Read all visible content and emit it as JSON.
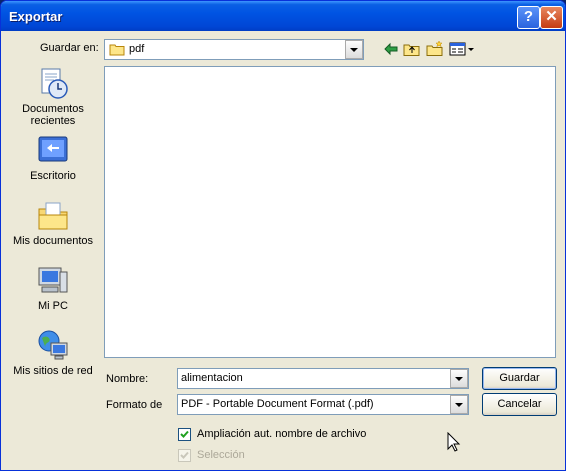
{
  "window": {
    "title": "Exportar"
  },
  "toolbar": {
    "save_in_label": "Guardar en:",
    "save_in_value": "pdf"
  },
  "places": [
    {
      "label": "Documentos recientes",
      "icon": "recent-documents-icon"
    },
    {
      "label": "Escritorio",
      "icon": "desktop-icon"
    },
    {
      "label": "Mis documentos",
      "icon": "my-documents-icon"
    },
    {
      "label": "Mi PC",
      "icon": "my-computer-icon"
    },
    {
      "label": "Mis sitios de red",
      "icon": "network-places-icon"
    }
  ],
  "form": {
    "name_label": "Nombre:",
    "name_value": "alimentacion",
    "format_label": "Formato de",
    "format_value": "PDF - Portable Document Format (.pdf)",
    "auto_ext_label": "Ampliación aut. nombre de archivo",
    "selection_label": "Selección"
  },
  "buttons": {
    "save": "Guardar",
    "cancel": "Cancelar"
  },
  "colors": {
    "titlebar": "#0054e3",
    "dialog": "#ece9d8",
    "border": "#7f9db9"
  }
}
